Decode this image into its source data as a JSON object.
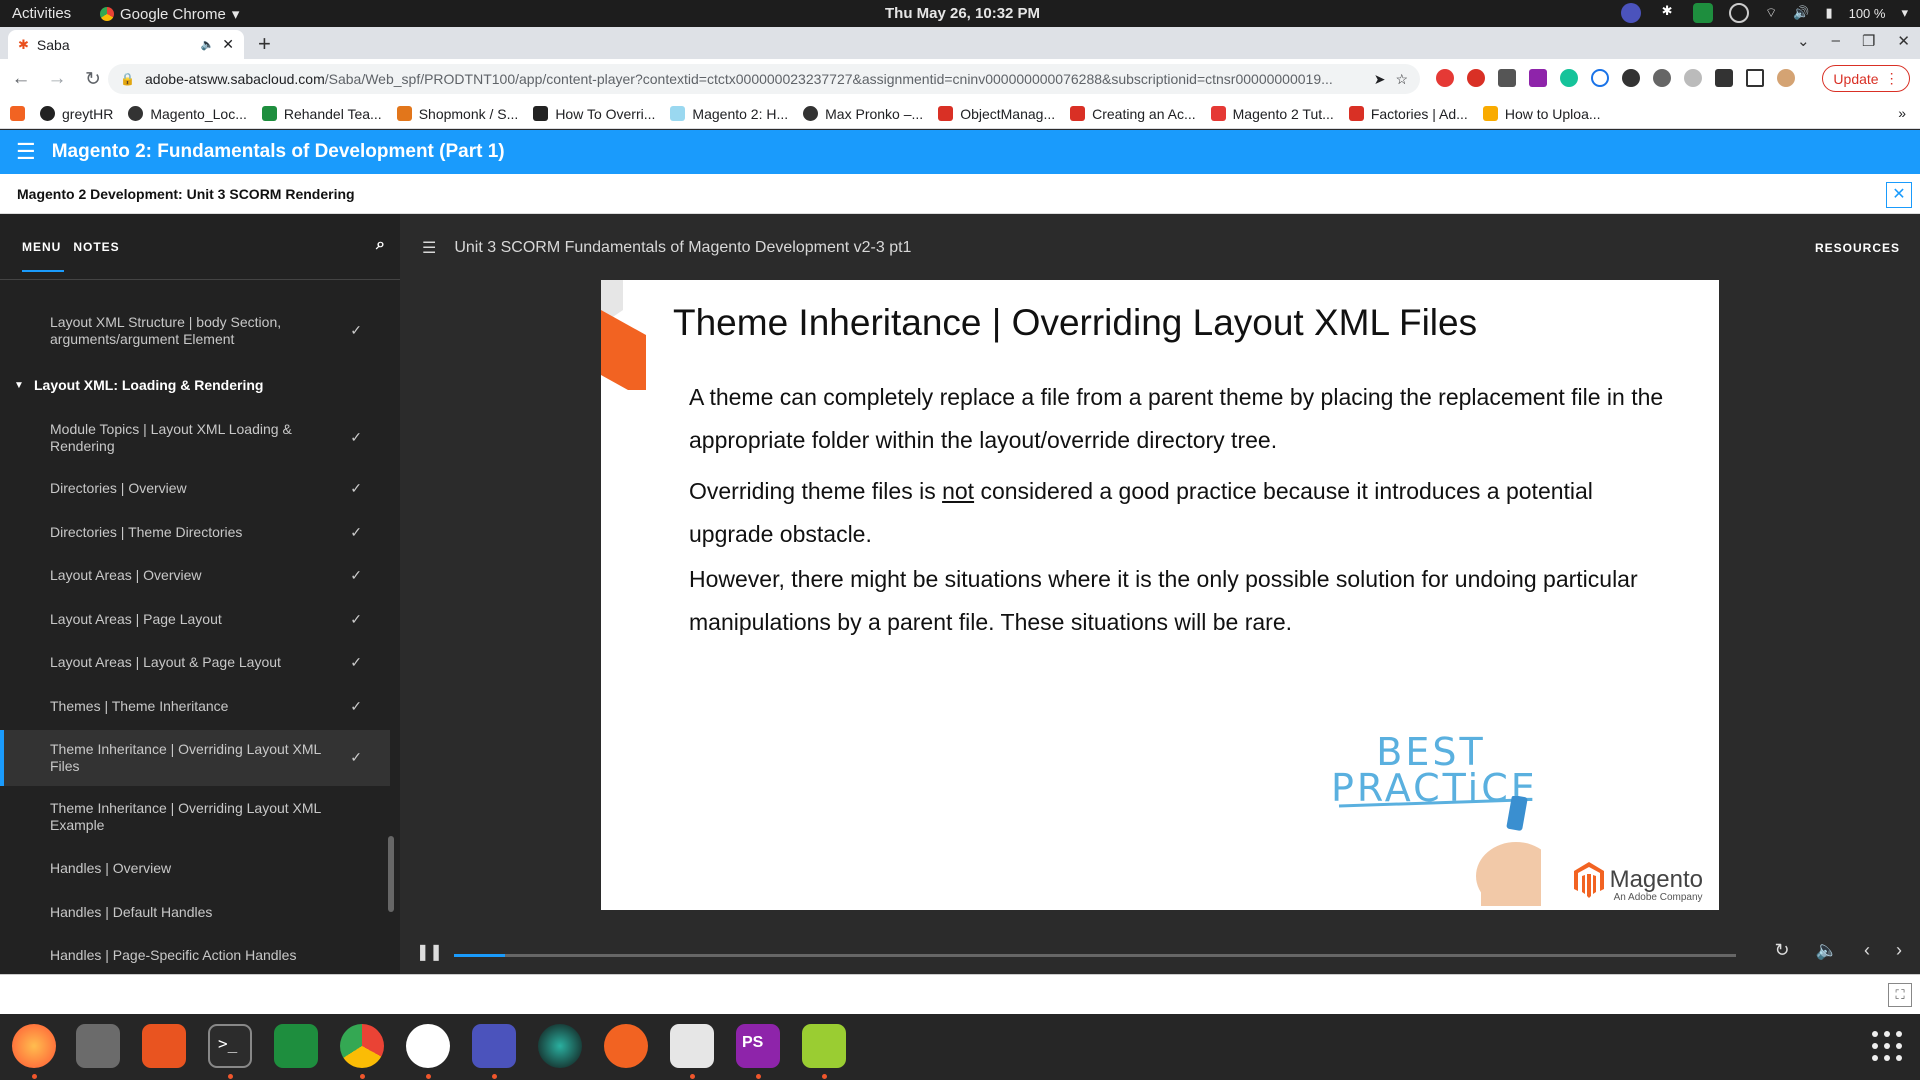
{
  "system_bar": {
    "activities": "Activities",
    "app_name": "Google Chrome",
    "clock": "Thu May 26, 10:32 PM",
    "battery": "100 %"
  },
  "browser": {
    "tab_title": "Saba",
    "url_host": "adobe-atsww.sabacloud.com",
    "url_path": "/Saba/Web_spf/PRODTNT100/app/content-player?contextid=ctctx000000023237727&assignmentid=cninv000000000076288&subscriptionid=ctnsr00000000019...",
    "update_label": "Update",
    "bookmarks": [
      {
        "label": "greytHR",
        "color": "#222222"
      },
      {
        "label": "Magento_Loc...",
        "color": "#333333"
      },
      {
        "label": "Rehandel Tea...",
        "color": "#1e8e3e"
      },
      {
        "label": "Shopmonk / S...",
        "color": "#e2761b"
      },
      {
        "label": "How To Overri...",
        "color": "#222222"
      },
      {
        "label": "Magento 2: H...",
        "color": "#9ad8f0"
      },
      {
        "label": "Max Pronko –...",
        "color": "#333333"
      },
      {
        "label": "ObjectManag...",
        "color": "#d93025"
      },
      {
        "label": "Creating an Ac...",
        "color": "#d93025"
      },
      {
        "label": "Magento 2 Tut...",
        "color": "#e53935"
      },
      {
        "label": "Factories | Ad...",
        "color": "#d93025"
      },
      {
        "label": "How to Uploa...",
        "color": "#f9ab00"
      }
    ]
  },
  "saba": {
    "course_title": "Magento 2: Fundamentals of Development (Part 1)",
    "unit_title": "Magento 2 Development: Unit 3 SCORM Rendering"
  },
  "sidebar": {
    "tab_menu": "MENU",
    "tab_notes": "NOTES",
    "items": [
      {
        "label": "Layout XML Structure | body Section, arguments/argument Element",
        "check": "✓"
      },
      {
        "label": "Module Topics | Layout XML Loading & Rendering",
        "check": "✓"
      },
      {
        "label": "Directories | Overview",
        "check": "✓"
      },
      {
        "label": "Directories | Theme Directories",
        "check": "✓"
      },
      {
        "label": "Layout Areas | Overview",
        "check": "✓"
      },
      {
        "label": "Layout Areas | Page Layout",
        "check": "✓"
      },
      {
        "label": "Layout Areas | Layout & Page Layout",
        "check": "✓"
      },
      {
        "label": "Themes | Theme Inheritance",
        "check": "✓"
      },
      {
        "label": "Theme Inheritance | Overriding Layout XML Files",
        "check": "✓"
      },
      {
        "label": "Theme Inheritance | Overriding Layout XML Example",
        "check": ""
      },
      {
        "label": "Handles | Overview",
        "check": ""
      },
      {
        "label": "Handles | Default Handles",
        "check": ""
      },
      {
        "label": "Handles | Page-Specific Action Handles",
        "check": ""
      }
    ],
    "section_label": "Layout XML: Loading & Rendering"
  },
  "player": {
    "header_title": "Unit 3 SCORM Fundamentals of Magento Development v2-3 pt1",
    "resources": "RESOURCES",
    "progress_fraction": 0.04
  },
  "slide": {
    "title": "Theme Inheritance | Overriding Layout XML Files",
    "p1": "A theme can completely replace a file from a parent theme by placing the replacement file in the appropriate folder within the layout/override directory tree.",
    "p2_pre": "Overriding theme files is ",
    "p2_u": "not",
    "p2_post": " considered a good practice because it introduces a potential upgrade obstacle.",
    "p3": "However, there might be situations where it is the only possible solution  for undoing particular manipulations by a parent file. These situations will be rare.",
    "best1": "BEST",
    "best2": "PRACTiCE",
    "brand": "Magento",
    "brand_sub": "An Adobe Company"
  },
  "colors": {
    "accent": "#1a9bfc",
    "sidebar_bg": "#222222",
    "player_bg": "#2b2b2b"
  }
}
